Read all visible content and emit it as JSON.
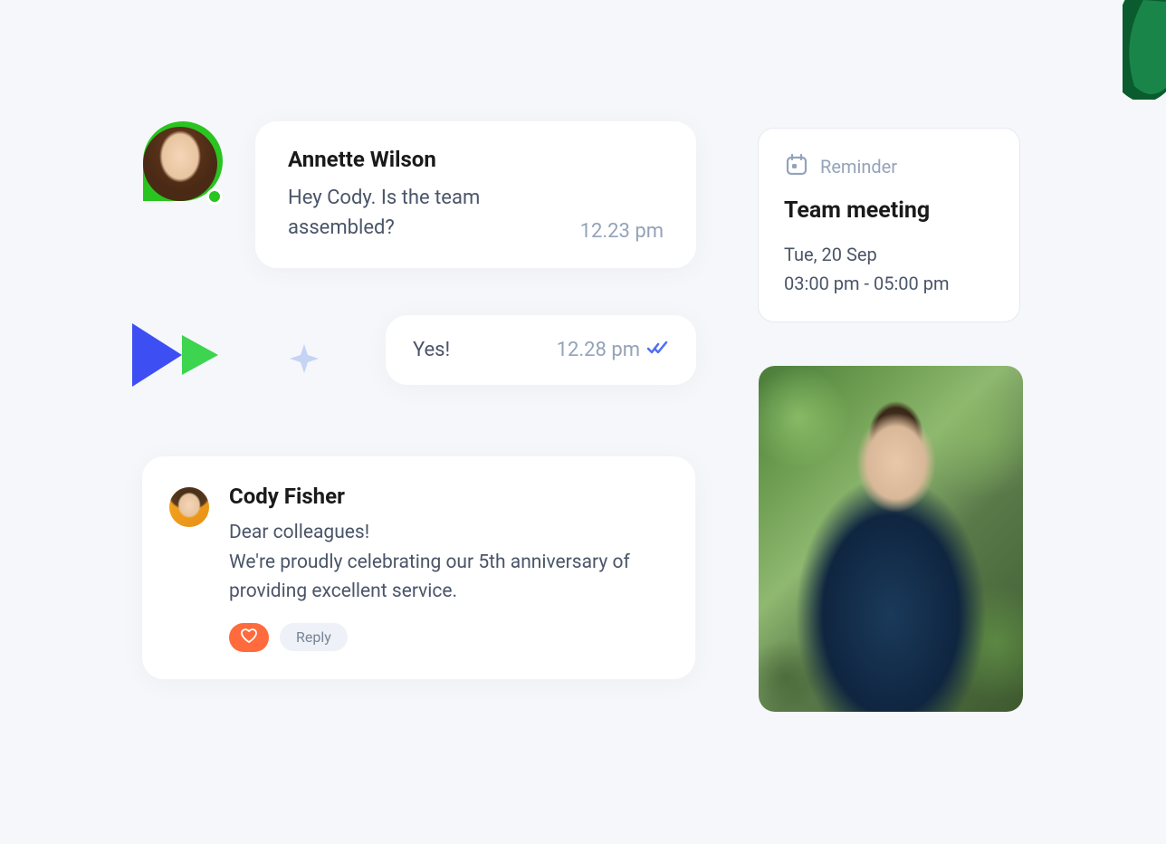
{
  "chat": {
    "message1": {
      "sender": "Annette Wilson",
      "text": "Hey Cody. Is the team assembled?",
      "time": "12.23 pm"
    },
    "reply": {
      "text": "Yes!",
      "time": "12.28 pm"
    }
  },
  "post": {
    "author": "Cody Fisher",
    "text": "Dear colleagues!\nWe're proudly celebrating our 5th anniversary of providing excellent service.",
    "reply_label": "Reply"
  },
  "reminder": {
    "label": "Reminder",
    "title": "Team meeting",
    "date": "Tue, 20 Sep",
    "time": "03:00 pm - 05:00 pm"
  },
  "colors": {
    "accent_green": "#2ac420",
    "accent_blue": "#4f6ff2",
    "accent_orange": "#ff6b3d",
    "muted": "#94a3b8"
  }
}
